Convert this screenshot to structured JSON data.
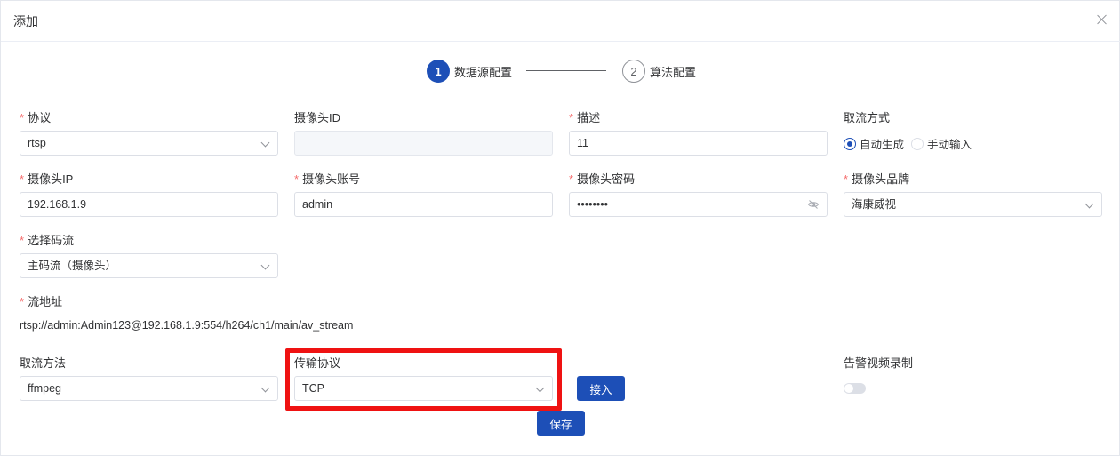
{
  "dialog": {
    "title": "添加"
  },
  "steps": [
    {
      "number": "1",
      "label": "数据源配置"
    },
    {
      "number": "2",
      "label": "算法配置"
    }
  ],
  "form": {
    "protocol": {
      "label": "协议",
      "value": "rtsp"
    },
    "camera_id": {
      "label": "摄像头ID",
      "value": ""
    },
    "description": {
      "label": "描述",
      "value": "11"
    },
    "stream_mode": {
      "label": "取流方式",
      "options": [
        "自动生成",
        "手动输入"
      ],
      "selected": "自动生成"
    },
    "camera_ip": {
      "label": "摄像头IP",
      "value": "192.168.1.9"
    },
    "camera_account": {
      "label": "摄像头账号",
      "value": "admin"
    },
    "camera_password": {
      "label": "摄像头密码",
      "value": "••••••••"
    },
    "camera_brand": {
      "label": "摄像头品牌",
      "value": "海康威视"
    },
    "stream_select": {
      "label": "选择码流",
      "value": "主码流（摄像头）"
    },
    "stream_url": {
      "label": "流地址",
      "value": "rtsp://admin:Admin123@192.168.1.9:554/h264/ch1/main/av_stream"
    },
    "pull_method": {
      "label": "取流方法",
      "value": "ffmpeg"
    },
    "transport": {
      "label": "传输协议",
      "value": "TCP"
    },
    "alarm_record": {
      "label": "告警视频录制",
      "enabled": false
    }
  },
  "buttons": {
    "connect": "接入",
    "save": "保存"
  },
  "colors": {
    "primary": "#1d4fb7",
    "required": "#f56c6c",
    "highlight": "#ef1212"
  }
}
